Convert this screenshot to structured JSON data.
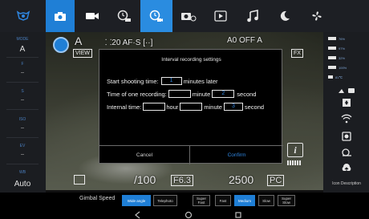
{
  "top_bar": {
    "tabs": [
      {
        "icon": "gimbal-logo-icon"
      },
      {
        "icon": "camera-icon"
      },
      {
        "icon": "video-camera-icon"
      },
      {
        "icon": "timelapse-icon"
      },
      {
        "icon": "interval-recording-icon",
        "active": true
      },
      {
        "icon": "motion-timelapse-icon"
      },
      {
        "icon": "play-icon"
      },
      {
        "icon": "music-note-icon"
      },
      {
        "icon": "moon-icon"
      },
      {
        "icon": "fan-icon"
      }
    ],
    "accent_color": "#1f7fd6"
  },
  "left_panel": {
    "items": [
      {
        "label": "MODE",
        "value": "A"
      },
      {
        "label": "F",
        "value": "--"
      },
      {
        "label": "S",
        "value": "--"
      },
      {
        "label": "ISO",
        "value": "--"
      },
      {
        "label": "EV",
        "value": "--"
      },
      {
        "label": "WB",
        "value": "Auto"
      }
    ]
  },
  "viewfinder": {
    "mode": "A",
    "quality_info": "⸬20  AF·S  [··]",
    "af_badge": "VIEW",
    "status_info": "A0  OFF  A",
    "fx_badge": "FX",
    "aperture": "F6.3",
    "shutter_hint": "/100",
    "shots_remaining": "2500",
    "pc_badge": "PC",
    "info_badge": "i"
  },
  "dialog": {
    "title": "Interval recording settings",
    "start_label": "Start shooting time:",
    "start_value": "1",
    "start_unit": "minutes later",
    "recording_label": "Time of one recording:",
    "recording_minute": "",
    "recording_minute_unit": "minute",
    "recording_second": "2",
    "recording_second_unit": "second",
    "internal_label": "Internal time:",
    "internal_hour": "",
    "internal_hour_unit": "hour",
    "internal_minute": "",
    "internal_minute_unit": "minute",
    "internal_second": "3",
    "internal_second_unit": "second",
    "cancel_label": "Cancel",
    "confirm_label": "Confirm"
  },
  "right_panel": {
    "battery_rows": [
      {
        "value": "76%"
      },
      {
        "value": "97%"
      },
      {
        "value": "32%"
      },
      {
        "value": "100%"
      },
      {
        "value": "81℃"
      }
    ],
    "icons": [
      "flip-icon",
      "wifi-icon",
      "shutter-icon",
      "snail-icon",
      "upload-icon"
    ],
    "icon_description": "Icon Description"
  },
  "gimbal_bar": {
    "label": "Gimbal Speed",
    "options": [
      {
        "label": "Wide angle",
        "selected": true
      },
      {
        "label": "Telephoto",
        "selected": false
      },
      {
        "label": "Super Fast",
        "selected": false
      },
      {
        "label": "Fast",
        "selected": false
      },
      {
        "label": "Medium",
        "selected": true
      },
      {
        "label": "Slow",
        "selected": false
      },
      {
        "label": "Super Slow",
        "selected": false
      }
    ]
  },
  "nav_bar": {
    "icons": [
      "back-icon",
      "home-icon",
      "recents-icon"
    ]
  }
}
